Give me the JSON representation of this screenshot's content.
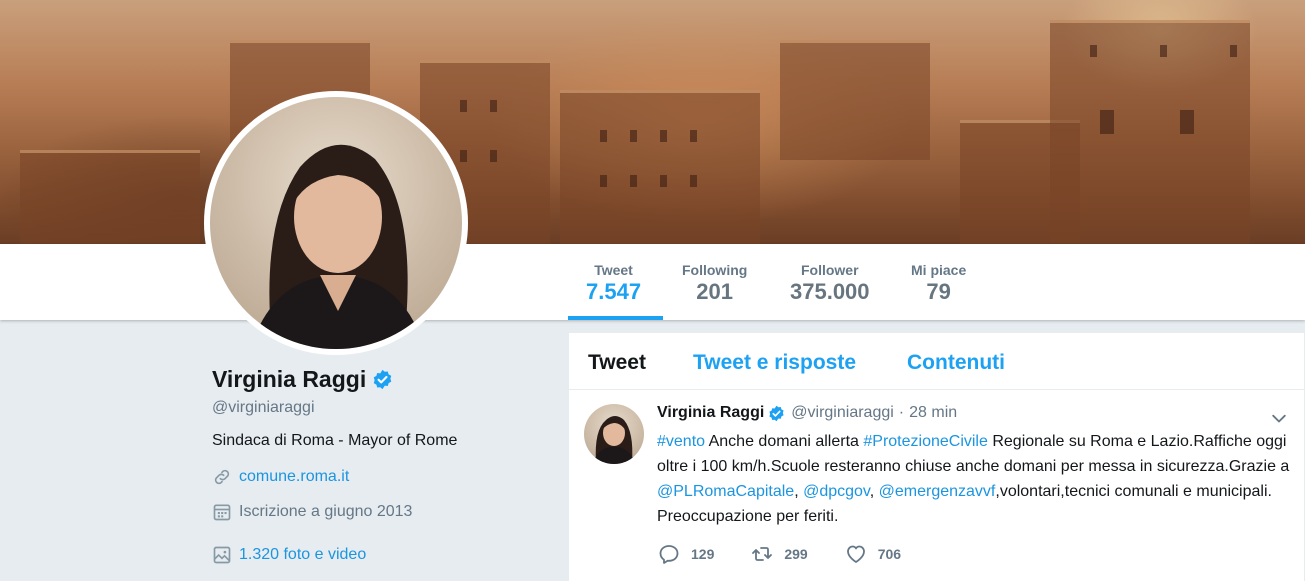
{
  "profile": {
    "name": "Virginia Raggi",
    "handle": "@virginiaraggi",
    "bio": "Sindaca di Roma - Mayor of Rome",
    "website": "comune.roma.it",
    "joined": "Iscrizione a giugno 2013",
    "media": "1.320 foto e video"
  },
  "stats": [
    {
      "label": "Tweet",
      "value": "7.547"
    },
    {
      "label": "Following",
      "value": "201"
    },
    {
      "label": "Follower",
      "value": "375.000"
    },
    {
      "label": "Mi piace",
      "value": "79"
    }
  ],
  "tabs": [
    {
      "label": "Tweet"
    },
    {
      "label": "Tweet e risposte"
    },
    {
      "label": "Contenuti"
    }
  ],
  "tweet": {
    "name": "Virginia Raggi",
    "handle": "@virginiaraggi",
    "separator": "·",
    "time": "28 min",
    "text": {
      "hashtag_vento": "#vento",
      "part1": " Anche domani allerta ",
      "hashtag_protezione": "#ProtezioneCivile",
      "part2": " Regionale su Roma e Lazio.Raffiche oggi oltre i 100 km/h.Scuole resteranno chiuse anche domani per messa in sicurezza.Grazie a ",
      "mention_pl": "@PLRomaCapitale",
      "comma1": ", ",
      "mention_dpc": "@dpcgov",
      "comma2": ", ",
      "mention_vvf": "@emergenzavvf",
      "part3": ",volontari,tecnici comunali e municipali. Preoccupazione per feriti."
    },
    "replies": "129",
    "retweets": "299",
    "likes": "706"
  },
  "colors": {
    "accent": "#1da1f2",
    "link": "#1b95e0",
    "background": "#e6ecf0",
    "muted": "#657786"
  },
  "icons": [
    "verified-icon",
    "link-icon",
    "calendar-icon",
    "image-icon",
    "chevron-down-icon",
    "reply-icon",
    "retweet-icon",
    "heart-icon"
  ]
}
